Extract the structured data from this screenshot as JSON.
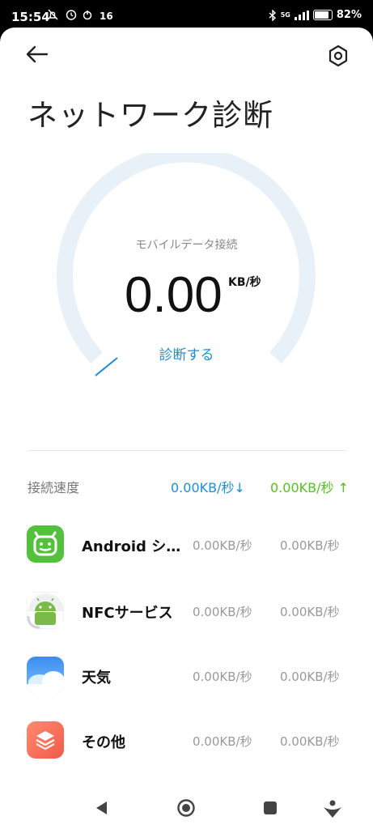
{
  "status_bar": {
    "time": "15:54",
    "notification_count": "16",
    "network": "5G",
    "battery": "82%"
  },
  "header": {
    "title": "ネットワーク診断"
  },
  "gauge": {
    "label": "モバイルデータ接続",
    "value": "0.00",
    "unit": "KB/秒",
    "action": "診断する",
    "progress": 0.0
  },
  "speed": {
    "label": "接続速度",
    "download": "0.00KB/秒↓",
    "upload": "0.00KB/秒 ↑"
  },
  "apps": [
    {
      "name": "Android シ…",
      "down": "0.00KB/秒",
      "up": "0.00KB/秒",
      "icon": "android-system-icon"
    },
    {
      "name": "NFCサービス",
      "down": "0.00KB/秒",
      "up": "0.00KB/秒",
      "icon": "android-robot-icon"
    },
    {
      "name": "天気",
      "down": "0.00KB/秒",
      "up": "0.00KB/秒",
      "icon": "weather-icon"
    },
    {
      "name": "その他",
      "down": "0.00KB/秒",
      "up": "0.00KB/秒",
      "icon": "layers-icon"
    }
  ],
  "colors": {
    "accent_blue": "#1a8fd6",
    "accent_green": "#52c41a",
    "gauge_track": "#e8f0f8"
  }
}
